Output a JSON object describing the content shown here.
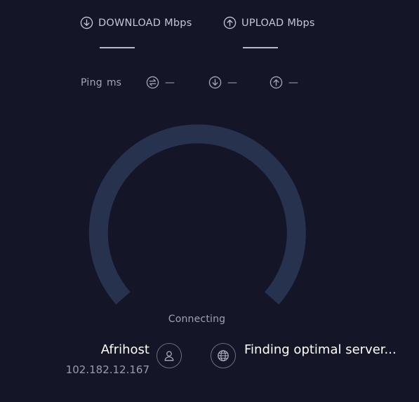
{
  "metrics": {
    "download": {
      "label": "DOWNLOAD",
      "unit": "Mbps",
      "icon": "arrow-down-circle-icon"
    },
    "upload": {
      "label": "UPLOAD",
      "unit": "Mbps",
      "icon": "arrow-up-circle-icon"
    }
  },
  "ping": {
    "label": "Ping",
    "unit": "ms",
    "idle_value": "—",
    "download_value": "—",
    "upload_value": "—"
  },
  "gauge": {
    "status": "Connecting",
    "track_color": "#27324f",
    "progress": 0
  },
  "connection": {
    "isp_name": "Afrihost",
    "ip_address": "102.182.12.167",
    "server_status": "Finding optimal server..."
  },
  "colors": {
    "background": "#141526",
    "text_primary": "#ffffff",
    "text_muted": "#9fa1b2"
  }
}
